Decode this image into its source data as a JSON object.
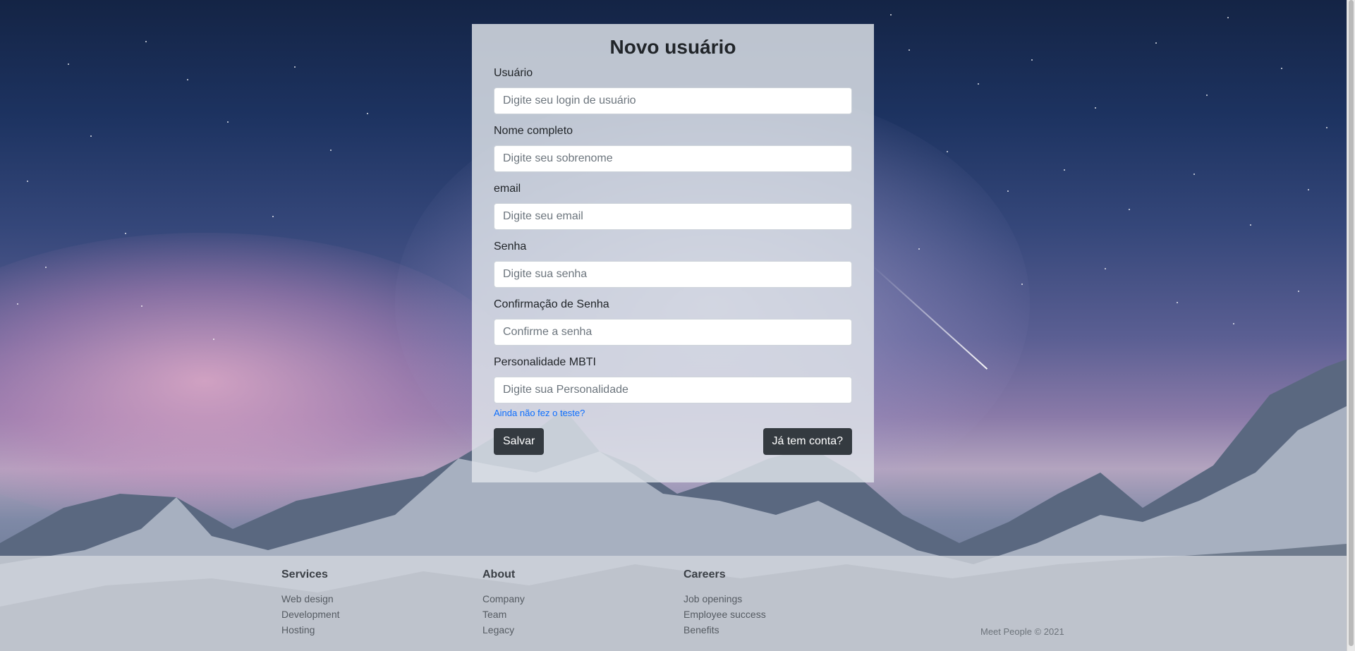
{
  "form": {
    "title": "Novo usuário",
    "fields": [
      {
        "label": "Usuário",
        "placeholder": "Digite seu login de usuário",
        "value": ""
      },
      {
        "label": "Nome completo",
        "placeholder": "Digite seu sobrenome",
        "value": ""
      },
      {
        "label": "email",
        "placeholder": "Digite seu email",
        "value": ""
      },
      {
        "label": "Senha",
        "placeholder": "Digite sua senha",
        "value": ""
      },
      {
        "label": "Confirmação de Senha",
        "placeholder": "Confirme a senha",
        "value": ""
      },
      {
        "label": "Personalidade MBTI",
        "placeholder": "Digite sua Personalidade",
        "value": ""
      }
    ],
    "test_link": "Ainda não fez o teste?",
    "save_label": "Salvar",
    "login_label": "Já tem conta?"
  },
  "footer": {
    "columns": [
      {
        "title": "Services",
        "items": [
          "Web design",
          "Development",
          "Hosting"
        ]
      },
      {
        "title": "About",
        "items": [
          "Company",
          "Team",
          "Legacy"
        ]
      },
      {
        "title": "Careers",
        "items": [
          "Job openings",
          "Employee success",
          "Benefits"
        ]
      }
    ],
    "copyright": "Meet People © 2021"
  },
  "colors": {
    "button": "#343a40",
    "link": "#0d6efd",
    "text": "#212529"
  }
}
